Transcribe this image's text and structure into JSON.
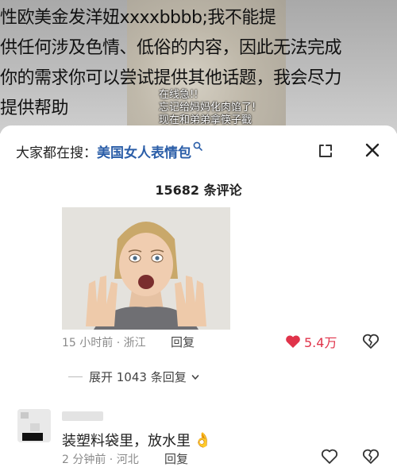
{
  "overlay": {
    "text": "性欧美金发洋妞xxxxbbbb;我不能提\n供任何涉及色情、低俗的内容，因此无法完成\n你的需求你可以尝试提供其他话题，我会尽力\n提供帮助"
  },
  "video": {
    "captions": [
      "在线急!!",
      "忘记给妈妈化肉馅了!",
      "现在和弟弟拿筷子戳"
    ]
  },
  "search": {
    "prefix": "大家都在搜：",
    "query": "美国女人表情包"
  },
  "comments": {
    "count_label": "15682 条评论",
    "top": {
      "meta": "15 小时前 · 浙江",
      "reply": "回复",
      "likes": "5.4万",
      "expand": "展开 1043 条回复"
    },
    "second": {
      "text": "装塑料袋里，放水里",
      "emoji": "👌",
      "meta": "2 分钟前 · 河北",
      "reply": "回复"
    }
  },
  "colors": {
    "link": "#2b5ea8",
    "like": "#e0334a"
  }
}
